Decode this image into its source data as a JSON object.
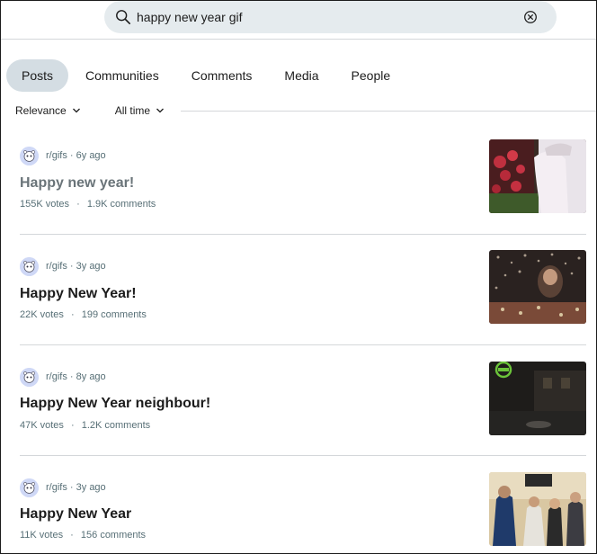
{
  "search": {
    "query": "happy new year gif"
  },
  "tabs": [
    {
      "label": "Posts",
      "active": true
    },
    {
      "label": "Communities",
      "active": false
    },
    {
      "label": "Comments",
      "active": false
    },
    {
      "label": "Media",
      "active": false
    },
    {
      "label": "People",
      "active": false
    }
  ],
  "filters": {
    "sort": "Relevance",
    "time": "All time"
  },
  "posts": [
    {
      "community": "r/gifs",
      "sep": "·",
      "age": "6y ago",
      "title": "Happy new year!",
      "votes": "155K votes",
      "dot": "·",
      "comments": "1.9K comments",
      "visited": true
    },
    {
      "community": "r/gifs",
      "sep": "·",
      "age": "3y ago",
      "title": "Happy New Year!",
      "votes": "22K votes",
      "dot": "·",
      "comments": "199 comments",
      "visited": false
    },
    {
      "community": "r/gifs",
      "sep": "·",
      "age": "8y ago",
      "title": "Happy New Year neighbour!",
      "votes": "47K votes",
      "dot": "·",
      "comments": "1.2K comments",
      "visited": false
    },
    {
      "community": "r/gifs",
      "sep": "·",
      "age": "3y ago",
      "title": "Happy New Year",
      "votes": "11K votes",
      "dot": "·",
      "comments": "156 comments",
      "visited": false
    }
  ],
  "colors": {
    "tab_active_bg": "#d4dde3",
    "search_bg": "#e5ebee",
    "meta_text": "#576f76"
  }
}
